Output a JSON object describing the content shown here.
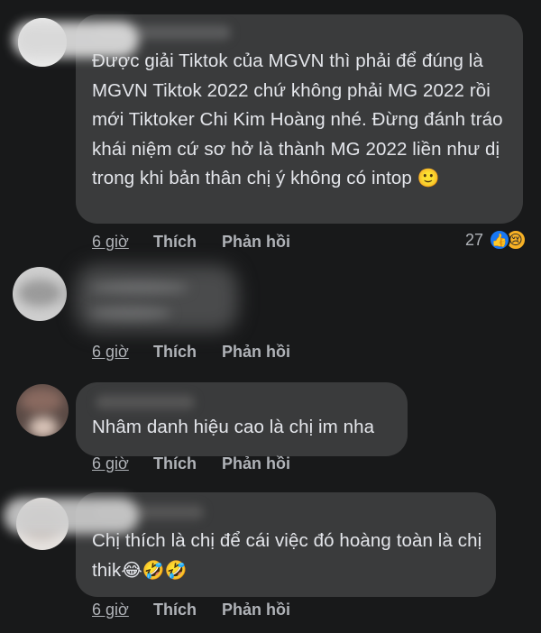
{
  "comments": [
    {
      "text": "Được giải Tiktok của MGVN thì phải để đúng là MGVN Tiktok 2022 chứ không phải MG 2022 rồi mới Tiktoker Chi Kim Hoàng nhé. Đừng đánh tráo khái niệm cứ sơ hở là thành MG 2022 liền như dị trong khi bản thân chị ý không có intop",
      "emoji": "🙂",
      "time": "6 giờ",
      "like": "Thích",
      "reply": "Phản hồi",
      "reaction_count": "27",
      "reaction_icons": [
        "like-reaction",
        "sad-reaction"
      ]
    },
    {
      "time": "6 giờ",
      "like": "Thích",
      "reply": "Phản hồi"
    },
    {
      "text": "Nhâm danh hiệu cao là chị im nha",
      "time": "6 giờ",
      "like": "Thích",
      "reply": "Phản hồi"
    },
    {
      "text": "Chị thích là chị để cái việc đó hoàng toàn là chị thik",
      "emoji": "😂🤣🤣",
      "time": "6 giờ",
      "like": "Thích",
      "reply": "Phản hồi"
    }
  ],
  "colors": {
    "background": "#18191a",
    "bubble": "#3a3b3c",
    "text": "#e4e6eb",
    "secondary": "#b0b3b8",
    "like_blue": "#1877f2",
    "sad_yellow": "#f7b125"
  }
}
